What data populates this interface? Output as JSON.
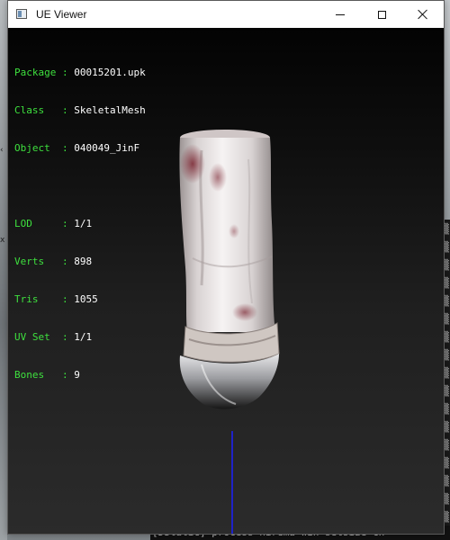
{
  "window": {
    "title": "UE Viewer",
    "controls": {
      "minimize": "minimize",
      "maximize": "maximize",
      "close": "close"
    }
  },
  "info": {
    "package": {
      "label": "Package",
      "value": "00015201.upk"
    },
    "class": {
      "label": "Class",
      "value": "SkeletalMesh"
    },
    "object": {
      "label": "Object",
      "value": "040049_JinF"
    },
    "lod": {
      "label": "LOD",
      "value": "1/1"
    },
    "verts": {
      "label": "Verts",
      "value": "898"
    },
    "tris": {
      "label": "Tris",
      "value": "1055"
    },
    "uvset": {
      "label": "UV Set",
      "value": "1/1"
    },
    "bones": {
      "label": "Bones",
      "value": "9"
    }
  },
  "background_console": {
    "bottom_line": "[DStatic] process  nirema win setsize  Ch"
  },
  "colors": {
    "label_green": "#3ee03e",
    "value_white": "#ffffff",
    "axis_blue": "#1f22c8",
    "viewport_top": "#030303",
    "viewport_bottom": "#2b2b2b"
  }
}
